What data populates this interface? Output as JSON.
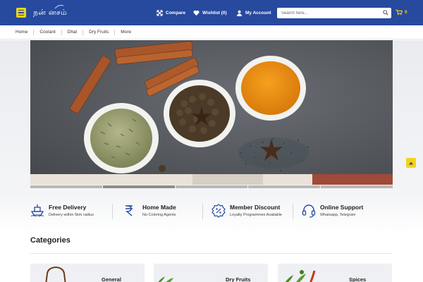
{
  "header": {
    "logo_text": "நன்  னசம்",
    "compare_label": "Compare",
    "wishlist_label": "Wishlist (0)",
    "account_label": "My Account",
    "search_placeholder": "Search here...",
    "cart_count": "0",
    "brand_color": "#27499e",
    "accent_color": "#f4d318"
  },
  "nav": {
    "items": [
      "Home",
      "Coolant",
      "Dhal",
      "Dry Fruits",
      "More"
    ]
  },
  "hero": {
    "slide_count": 5,
    "active_slide": 2
  },
  "features": [
    {
      "title": "Free Delivery",
      "subtitle": "Delivery within 5km radius",
      "icon": "ship-icon"
    },
    {
      "title": "Home Made",
      "subtitle": "No Coloring Agents",
      "icon": "rupee-icon"
    },
    {
      "title": "Member Discount",
      "subtitle": "Loyalty Programmes Available",
      "icon": "discount-badge-icon"
    },
    {
      "title": "Online Support",
      "subtitle": "Whatsapp, Telegram",
      "icon": "headset-icon"
    }
  ],
  "categories": {
    "title": "Categories",
    "items": [
      "General",
      "Dry Fruits",
      "Spices"
    ]
  }
}
